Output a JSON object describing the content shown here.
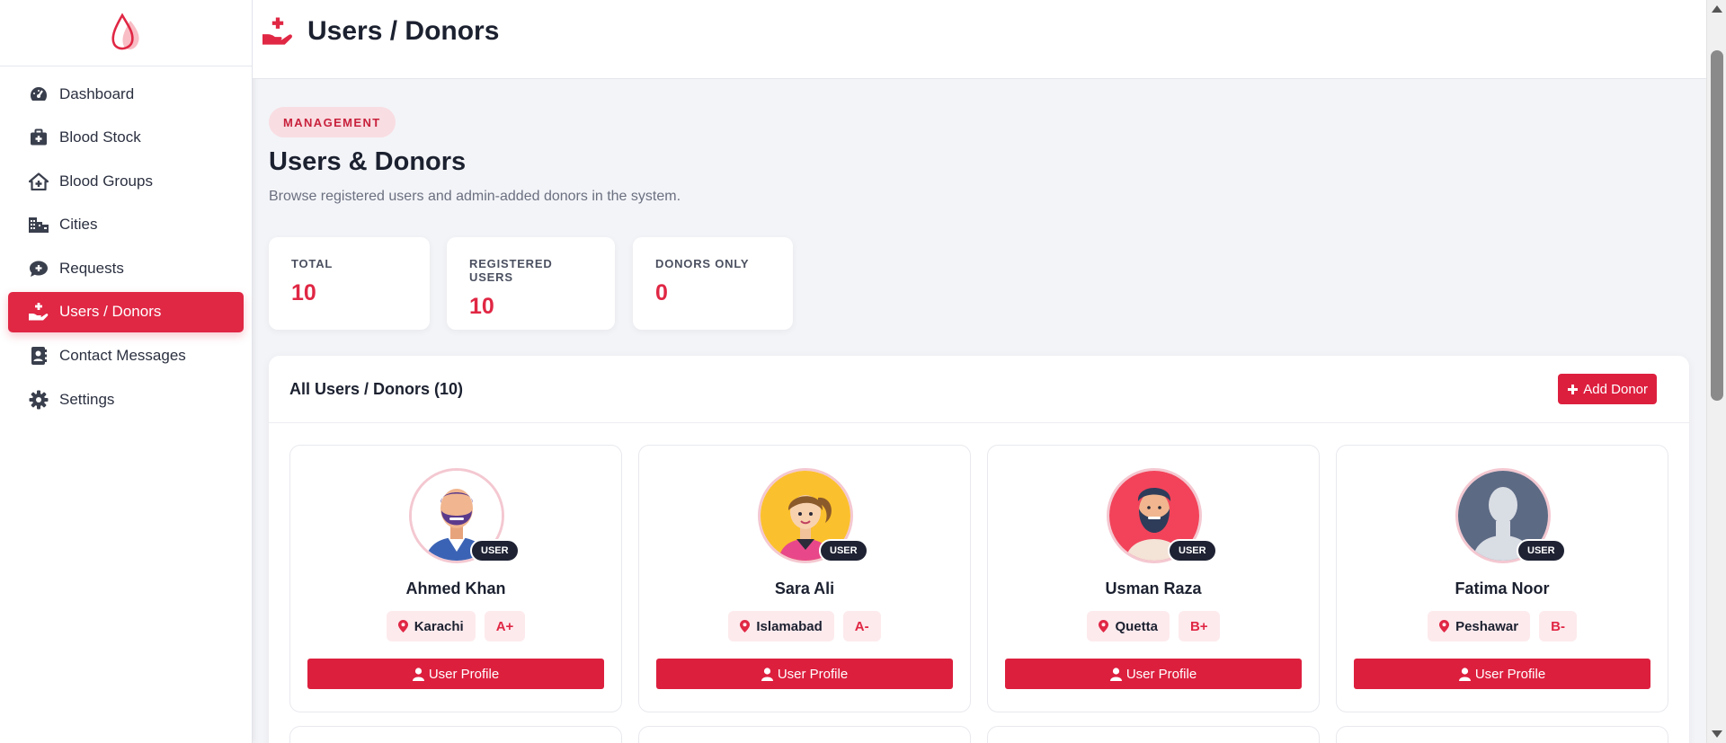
{
  "sidebar": {
    "items": [
      {
        "label": "Dashboard",
        "icon": "gauge-icon"
      },
      {
        "label": "Blood Stock",
        "icon": "medkit-icon"
      },
      {
        "label": "Blood Groups",
        "icon": "house-medical-icon"
      },
      {
        "label": "Cities",
        "icon": "city-icon"
      },
      {
        "label": "Requests",
        "icon": "comment-medical-icon"
      },
      {
        "label": "Users / Donors",
        "icon": "hand-holding-medical-icon",
        "active": true
      },
      {
        "label": "Contact Messages",
        "icon": "address-book-icon"
      },
      {
        "label": "Settings",
        "icon": "gear-icon"
      }
    ]
  },
  "topbar": {
    "title": "Users / Donors"
  },
  "page": {
    "badge": "MANAGEMENT",
    "heading": "Users & Donors",
    "subtitle": "Browse registered users and admin-added donors in the system."
  },
  "stats": [
    {
      "label": "TOTAL",
      "value": "10"
    },
    {
      "label": "REGISTERED USERS",
      "value": "10"
    },
    {
      "label": "DONORS ONLY",
      "value": "0"
    }
  ],
  "panel": {
    "title": "All Users / Donors (10)",
    "add_button": "Add Donor"
  },
  "cards": [
    {
      "name": "Ahmed Khan",
      "city": "Karachi",
      "blood_group": "A+",
      "role": "USER",
      "button": "User Profile"
    },
    {
      "name": "Sara Ali",
      "city": "Islamabad",
      "blood_group": "A-",
      "role": "USER",
      "button": "User Profile"
    },
    {
      "name": "Usman Raza",
      "city": "Quetta",
      "blood_group": "B+",
      "role": "USER",
      "button": "User Profile"
    },
    {
      "name": "Fatima Noor",
      "city": "Peshawar",
      "blood_group": "B-",
      "role": "USER",
      "button": "User Profile"
    }
  ],
  "colors": {
    "accent": "#e02744",
    "badge_bg": "#f8dde2",
    "role_badge": "#1e2233"
  }
}
